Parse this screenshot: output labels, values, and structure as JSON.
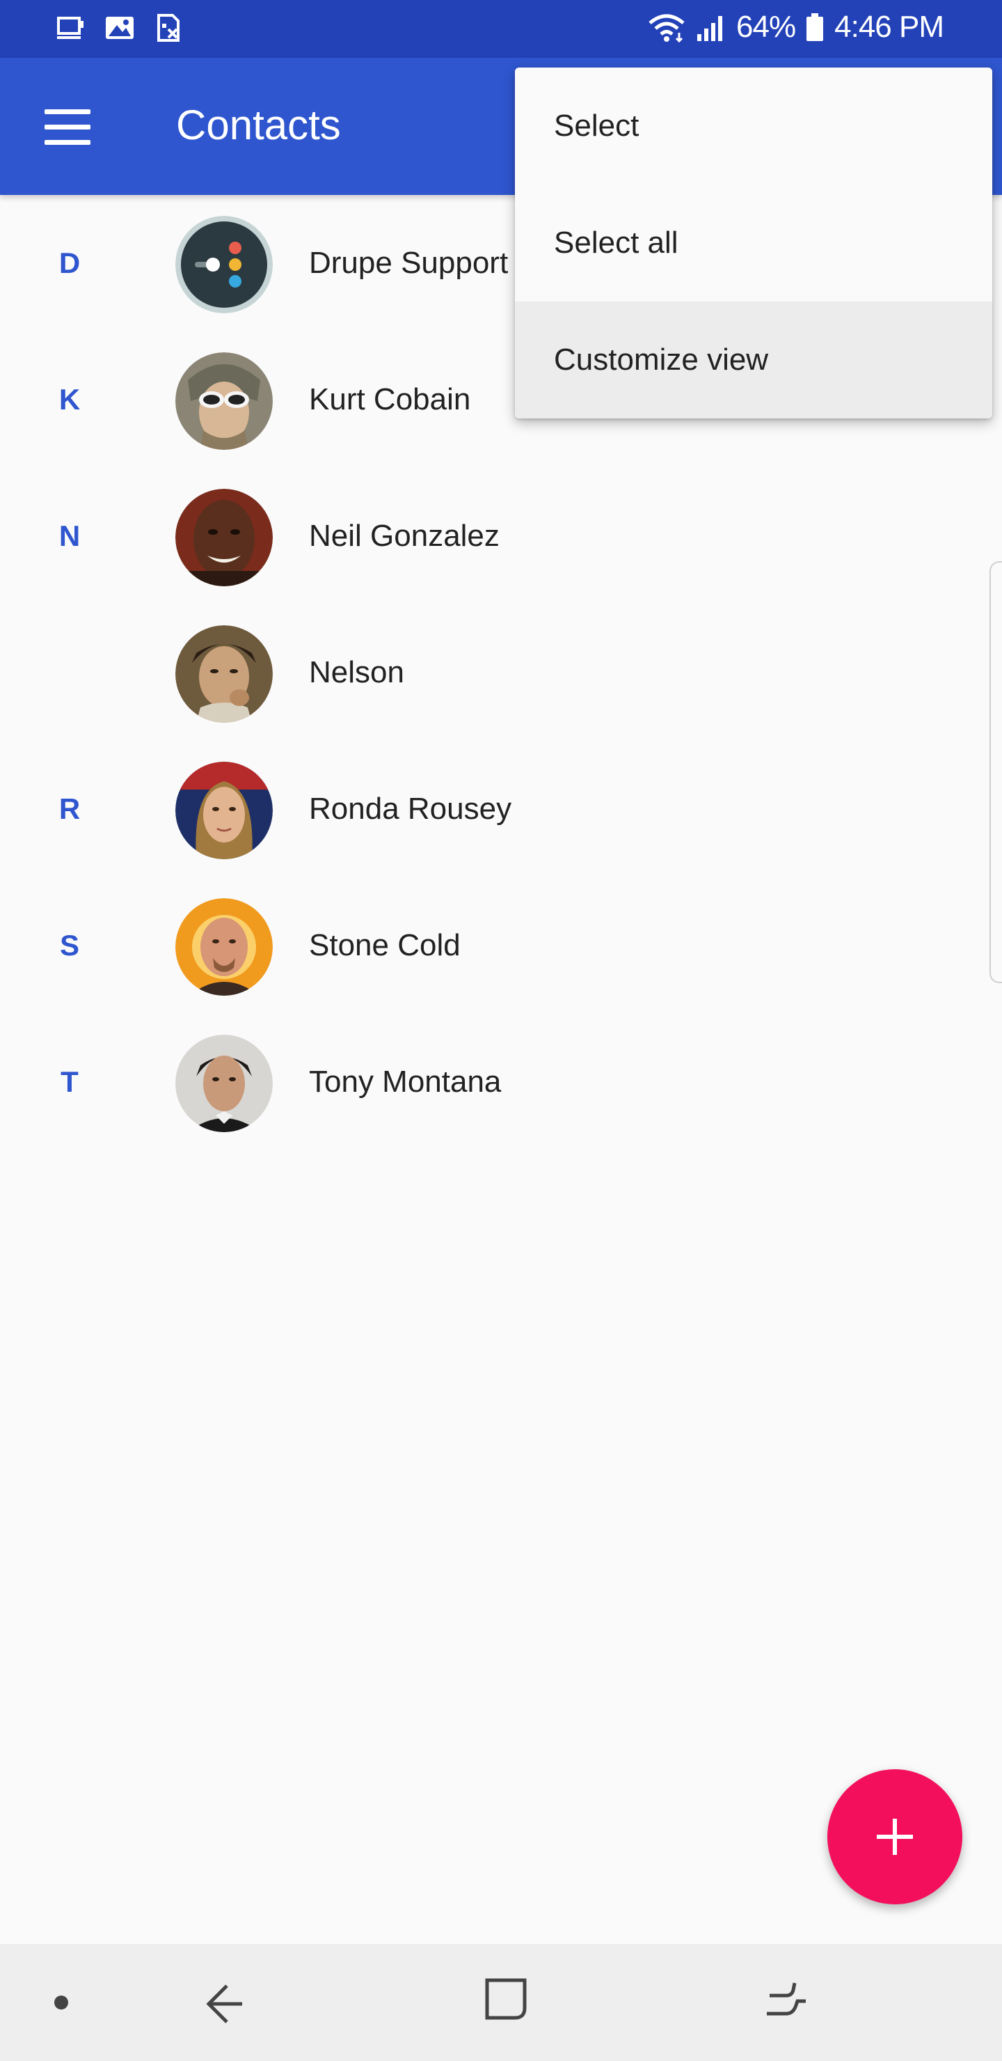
{
  "status_bar": {
    "battery_percent": "64%",
    "time": "4:46 PM",
    "left_icons": [
      "cast-icon",
      "image-icon",
      "sim-icon"
    ],
    "right_icons": [
      "wifi-icon",
      "signal-icon",
      "battery-icon"
    ]
  },
  "app_bar": {
    "title": "Contacts",
    "menu_icon": "hamburger-menu-icon"
  },
  "contacts": [
    {
      "letter": "D",
      "name": "Drupe Support",
      "avatar": "drupe-logo"
    },
    {
      "letter": "K",
      "name": "Kurt Cobain",
      "avatar": "photo"
    },
    {
      "letter": "N",
      "name": "Neil Gonzalez",
      "avatar": "photo"
    },
    {
      "letter": "",
      "name": "Nelson",
      "avatar": "photo"
    },
    {
      "letter": "R",
      "name": "Ronda Rousey",
      "avatar": "photo"
    },
    {
      "letter": "S",
      "name": "Stone Cold",
      "avatar": "photo"
    },
    {
      "letter": "T",
      "name": "Tony Montana",
      "avatar": "photo"
    }
  ],
  "overflow_menu": {
    "items": [
      {
        "label": "Select"
      },
      {
        "label": "Select all"
      },
      {
        "label": "Customize view",
        "highlighted": true
      }
    ]
  },
  "fab": {
    "icon": "plus-icon"
  },
  "nav_bar": {
    "icons": [
      "dot-icon",
      "back-icon",
      "home-icon",
      "recents-icon"
    ]
  },
  "colors": {
    "status_bar": "#2342b8",
    "app_bar": "#2f56cf",
    "accent_letter": "#2f56cf",
    "fab": "#f40f5c",
    "background": "#fafafa"
  }
}
